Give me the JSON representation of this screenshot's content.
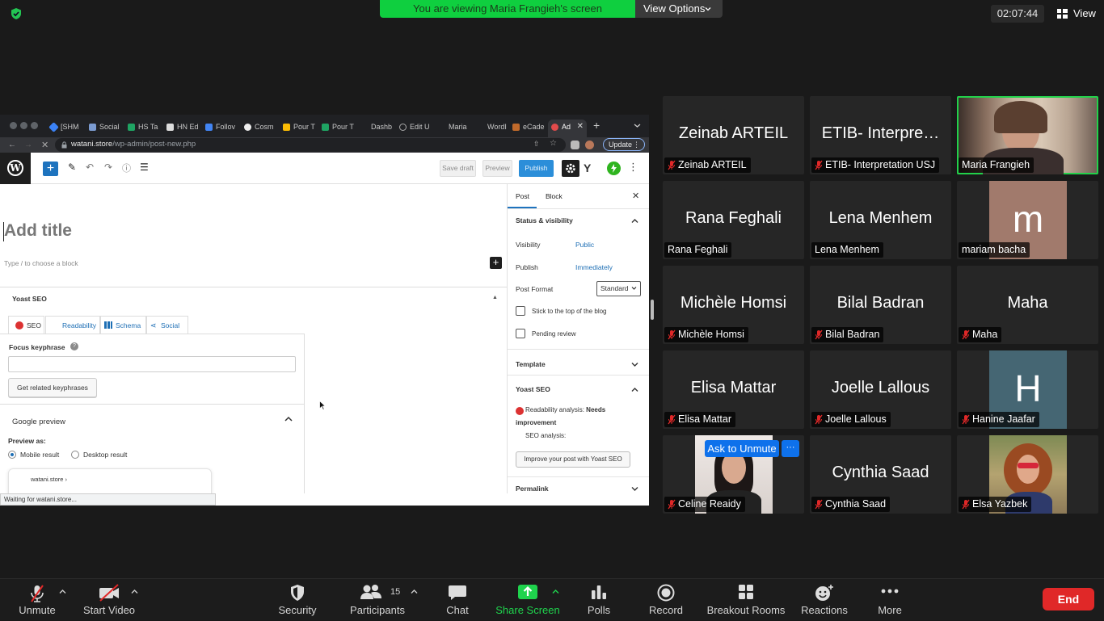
{
  "top": {
    "banner": "You are viewing Maria Frangieh's screen",
    "view_options": "View Options",
    "clock": "02:07:44",
    "view": "View"
  },
  "browser": {
    "tabs": [
      "[SHM",
      "Social",
      "HS Ta",
      "HN Ed",
      "Follov",
      "Cosm",
      "Pour T",
      "Pour T",
      "Dashb",
      "Edit U",
      "Maria",
      "WordI",
      "eCade",
      "Ad"
    ],
    "url_host": "watani.store",
    "url_path": "/wp-admin/post-new.php",
    "update": "Update",
    "status": "Waiting for watani.store..."
  },
  "wp": {
    "save_draft": "Save draft",
    "preview": "Preview",
    "publish": "Publish",
    "title_placeholder": "Add title",
    "block_hint": "Type / to choose a block",
    "yoast": {
      "header": "Yoast SEO",
      "tabs": [
        "SEO",
        "Readability",
        "Schema",
        "Social"
      ],
      "focus_label": "Focus keyphrase",
      "related_button": "Get related keyphrases",
      "google_preview": "Google preview",
      "preview_as": "Preview as:",
      "mobile": "Mobile result",
      "desktop": "Desktop result",
      "serp_site": "watani.store ›"
    },
    "sidebar": {
      "tab_post": "Post",
      "tab_block": "Block",
      "status_visibility": "Status & visibility",
      "visibility_label": "Visibility",
      "visibility_value": "Public",
      "publish_label": "Publish",
      "publish_value": "Immediately",
      "format_label": "Post Format",
      "format_value": "Standard",
      "sticky": "Stick to the top of the blog",
      "pending": "Pending review",
      "template": "Template",
      "yoast": "Yoast SEO",
      "readability_label": "Readability analysis:",
      "readability_value": "Needs improvement",
      "seo_analysis": "SEO analysis:",
      "improve_button": "Improve your post with Yoast SEO",
      "permalink": "Permalink"
    }
  },
  "participants": [
    {
      "display": "Zeinab ARTEIL",
      "name": "Zeinab ARTEIL",
      "muted": true
    },
    {
      "display": "ETIB- Interpre…",
      "name": "ETIB- Interpretation USJ",
      "muted": true
    },
    {
      "display": "",
      "name": "Maria Frangieh",
      "muted": false
    },
    {
      "display": "Rana Feghali",
      "name": "Rana Feghali",
      "muted": false
    },
    {
      "display": "Lena Menhem",
      "name": "Lena Menhem",
      "muted": false
    },
    {
      "display": "m",
      "name": "mariam bacha",
      "muted": false
    },
    {
      "display": "Michèle Homsi",
      "name": "Michèle Homsi",
      "muted": true
    },
    {
      "display": "Bilal Badran",
      "name": "Bilal Badran",
      "muted": true
    },
    {
      "display": "Maha",
      "name": "Maha",
      "muted": true
    },
    {
      "display": "Elisa Mattar",
      "name": "Elisa Mattar",
      "muted": true
    },
    {
      "display": "Joelle Lallous",
      "name": "Joelle Lallous",
      "muted": true
    },
    {
      "display": "H",
      "name": "Hanine Jaafar",
      "muted": true
    },
    {
      "display": "",
      "name": "Celine Reaidy",
      "muted": true
    },
    {
      "display": "Cynthia Saad",
      "name": "Cynthia Saad",
      "muted": true
    },
    {
      "display": "",
      "name": "Elsa Yazbek",
      "muted": true
    }
  ],
  "ask_unmute": "Ask to Unmute",
  "ask_more": "···",
  "toolbar": {
    "unmute": "Unmute",
    "start_video": "Start Video",
    "security": "Security",
    "participants": "Participants",
    "participants_count": "15",
    "chat": "Chat",
    "share_screen": "Share Screen",
    "polls": "Polls",
    "record": "Record",
    "breakout": "Breakout Rooms",
    "reactions": "Reactions",
    "more": "More",
    "end": "End"
  },
  "colors": {
    "banner": "#0fcf3f",
    "share_green": "#1fd34d",
    "end_red": "#e02828",
    "zoom_blue": "#0e71eb",
    "active_speaker": "#22d14a",
    "avatar_m": "#a17a6c",
    "avatar_h": "#456673"
  }
}
